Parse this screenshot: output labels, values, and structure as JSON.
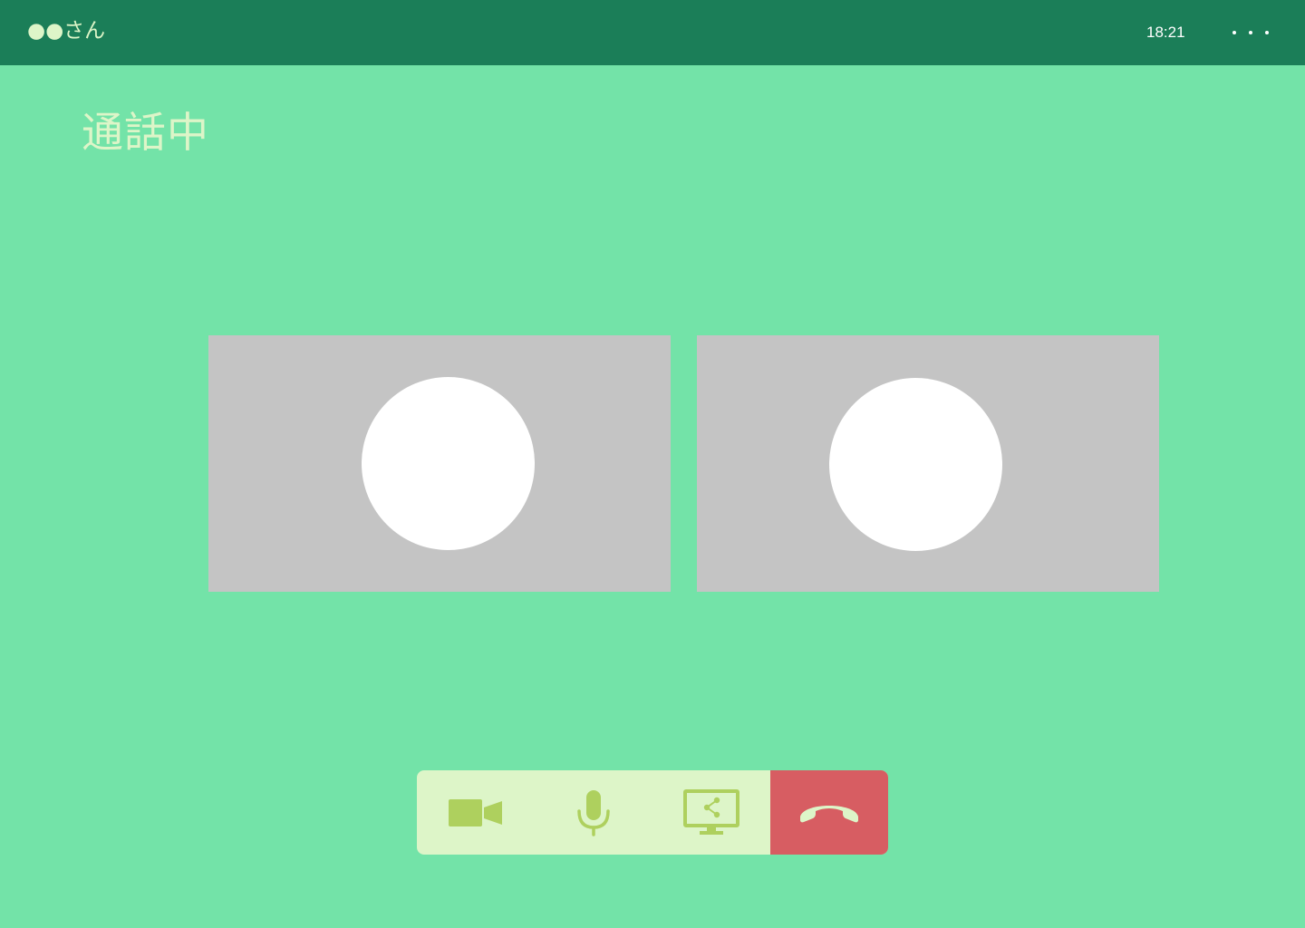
{
  "header": {
    "caller_name": "●●さん",
    "time": "18:21",
    "more_icon": "more-horizontal-icon"
  },
  "call": {
    "status_title": "通話中"
  },
  "controls": {
    "video_icon": "video-camera-icon",
    "mic_icon": "microphone-icon",
    "share_icon": "screen-share-icon",
    "hangup_icon": "phone-hangup-icon"
  },
  "colors": {
    "background": "#73e3a8",
    "header": "#1b7e58",
    "accent_text": "#ddf5c8",
    "control_bar": "#ddf5c8",
    "control_icon": "#aed05e",
    "hangup": "#d75d62",
    "video_tile": "#c4c4c4",
    "avatar": "#ffffff"
  }
}
